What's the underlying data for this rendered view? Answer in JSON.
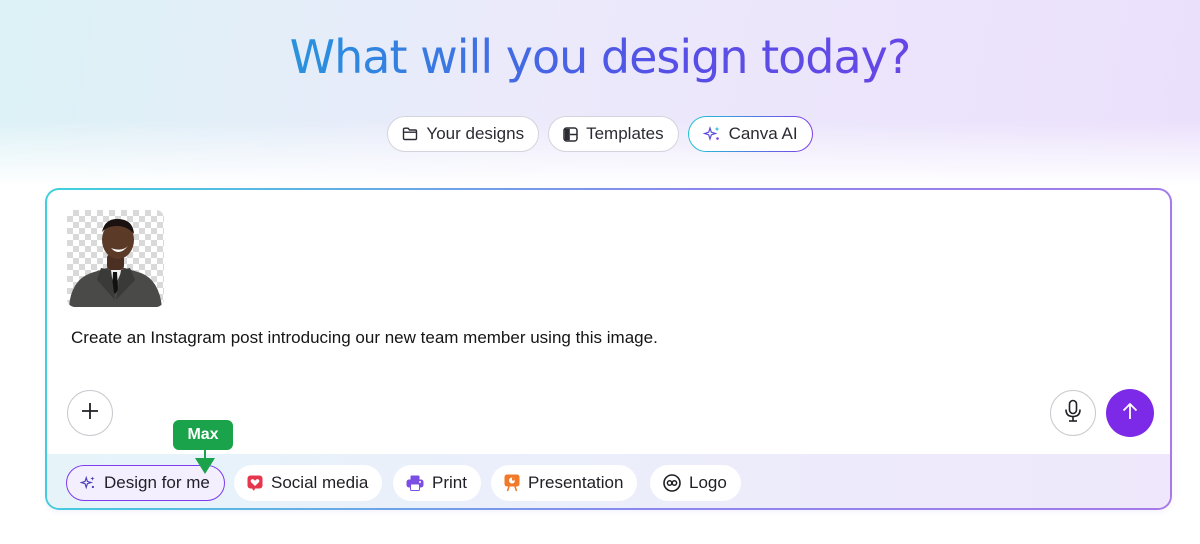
{
  "headline": "What will you design today?",
  "tabs": [
    {
      "label": "Your designs",
      "icon": "folder-icon"
    },
    {
      "label": "Templates",
      "icon": "template-icon"
    },
    {
      "label": "Canva AI",
      "icon": "sparkle-icon",
      "active": true
    }
  ],
  "prompt": {
    "attachment": "person-photo",
    "text": "Create an Instagram post introducing our new team member using this image."
  },
  "buttons": {
    "add_icon": "plus-icon",
    "mic_icon": "microphone-icon",
    "send_icon": "arrow-up-icon"
  },
  "suggestions": [
    {
      "label": "Design for me",
      "icon": "sparkle-icon",
      "selected": true
    },
    {
      "label": "Social media",
      "icon": "heart-icon"
    },
    {
      "label": "Print",
      "icon": "printer-icon"
    },
    {
      "label": "Presentation",
      "icon": "presentation-icon"
    },
    {
      "label": "Logo",
      "icon": "logo-icon"
    }
  ],
  "tooltip": {
    "label": "Max"
  },
  "colors": {
    "accent": "#7d2ae8",
    "tooltip": "#1aa34a",
    "social": "#e5364d",
    "print": "#7b4fe3",
    "presentation": "#f07a2a"
  }
}
